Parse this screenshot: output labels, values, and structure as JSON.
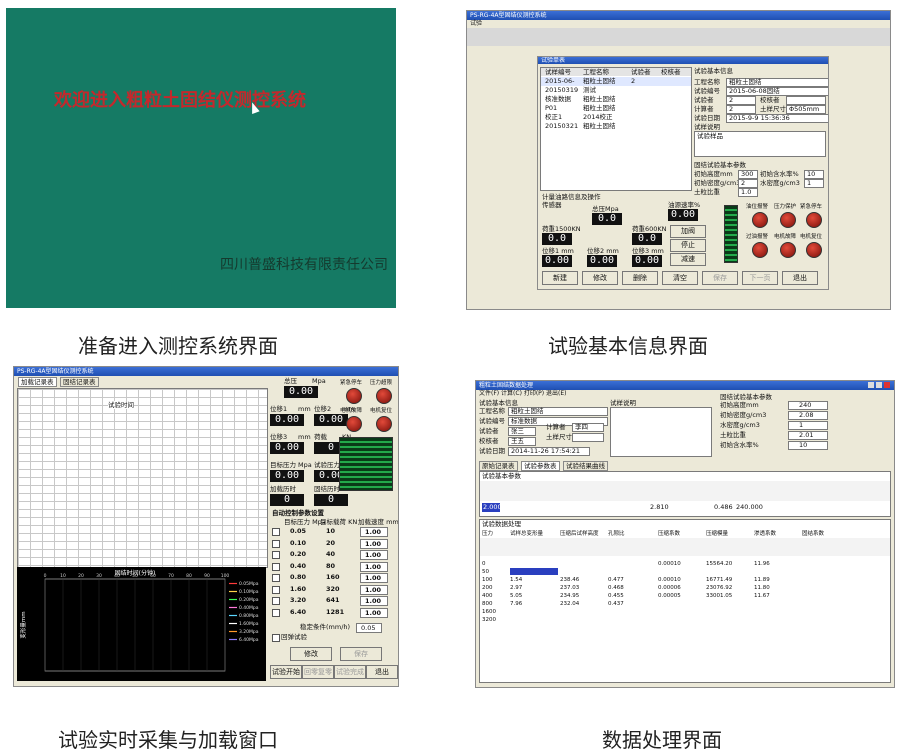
{
  "panel1": {
    "welcome": "欢迎进入粗粒土固结仪测控系统",
    "company": "四川普盛科技有限责任公司",
    "caption": "准备进入测控系统界面"
  },
  "panel2": {
    "caption": "试验基本信息界面",
    "window_title": "PS-RG-4A型固结仪测控系统",
    "menu": "试验",
    "group_list": "试验单表",
    "list_headers": [
      "试样编号",
      "工程名称",
      "试验者",
      "校核者"
    ],
    "list_rows": [
      [
        "2015-06-",
        "粗粒土固结",
        "2",
        ""
      ],
      [
        "20150319",
        "测试",
        "",
        ""
      ],
      [
        "核准数据",
        "粗粒土固结",
        "",
        ""
      ],
      [
        "P01",
        "粗粒土固结",
        "",
        ""
      ],
      [
        "校正1",
        "2014校正",
        "",
        ""
      ],
      [
        "20150321",
        "粗粒土固结",
        "",
        ""
      ]
    ],
    "basic_title": "试验基本信息",
    "fields": [
      {
        "label": "工程名称",
        "value": "粗粒土固结"
      },
      {
        "label": "试验编号",
        "value": "2015-06-08固结"
      },
      {
        "label": "试验者",
        "value": "2"
      },
      {
        "label": "计算者",
        "value": "2"
      },
      {
        "label": "试验日期",
        "value": "2015-9-9 15:36:36"
      }
    ],
    "checker_label": "校核者",
    "size_label": "土样尺寸",
    "size_value": "Φ505mm",
    "desc_label": "试样说明",
    "desc_value": "试验样品",
    "param_title": "固结试验基本参数",
    "params": [
      {
        "label": "初始高度mm",
        "value": "300"
      },
      {
        "label": "初始含水率%",
        "value": "10"
      },
      {
        "label": "初始密度g/cm3",
        "value": "2"
      },
      {
        "label": "水密度g/cm3",
        "value": "1"
      },
      {
        "label": "土粒比重",
        "value": "1.0"
      }
    ],
    "meter_title": "计量油路信息及操作",
    "sensor": "传感器",
    "total_label": "总压Mpa",
    "total_value": "0.0",
    "load1_label": "荷重1500KN",
    "load2_label": "荷重600KN",
    "load_value": "0.0",
    "disp_labels": [
      "位移1 mm",
      "位移2 mm",
      "位移3 mm"
    ],
    "disp_value": "0.00",
    "oil_label": "油源速率%",
    "oil_value": "0.00",
    "op_buttons": [
      "加阀",
      "停止",
      "减速"
    ],
    "status_labels": [
      "油位报警",
      "压力保护",
      "紧急停车",
      "过油报警",
      "电机故障",
      "电机复位"
    ],
    "buttons": [
      "新建",
      "修改",
      "删除",
      "清空",
      "保存",
      "下一页",
      "退出"
    ]
  },
  "panel3": {
    "caption": "试验实时采集与加载窗口",
    "window_title": "PS-RG-4A型固结仪测控系统",
    "tabs": [
      "加载记录表",
      "固结记录表"
    ],
    "table_title": "试验时间",
    "readouts": [
      {
        "label": "总压",
        "unit": "Mpa",
        "value": "0.00"
      },
      {
        "label": "位移1",
        "unit": "mm",
        "value": "0.00"
      },
      {
        "label": "位移2",
        "unit": "mm",
        "value": "0.00"
      },
      {
        "label": "位移3",
        "unit": "mm",
        "value": "0.00"
      },
      {
        "label": "荷载",
        "unit": "KN",
        "value": "0"
      },
      {
        "label": "目标压力",
        "unit": "Mpa",
        "value": "0.00"
      },
      {
        "label": "试验压力",
        "unit": "Mpa",
        "value": "0.00"
      },
      {
        "label": "加载历时",
        "unit": "",
        "value": "0"
      },
      {
        "label": "固结历时",
        "unit": "",
        "value": "0"
      }
    ],
    "alarm_labels": [
      "紧急停车",
      "压力超限",
      "电机故障",
      "电机复位"
    ],
    "control_title": "自动控制参数设置",
    "control_headers": [
      "目标压力 Mpa",
      "目标载荷 KN",
      "加载速度 mm/min"
    ],
    "control_rows": [
      [
        "0.05",
        "10",
        "1.00"
      ],
      [
        "0.10",
        "20",
        "1.00"
      ],
      [
        "0.20",
        "40",
        "1.00"
      ],
      [
        "0.40",
        "80",
        "1.00"
      ],
      [
        "0.80",
        "160",
        "1.00"
      ],
      [
        "1.60",
        "320",
        "1.00"
      ],
      [
        "3.20",
        "641",
        "1.00"
      ],
      [
        "6.40",
        "1281",
        "1.00"
      ]
    ],
    "stable_label": "稳定条件(mm/h)",
    "stable_value": "0.05",
    "loop_label": "回弹试验",
    "buttons": [
      "修改",
      "保存",
      "试验开始",
      "回零复零",
      "试验完成",
      "退出"
    ],
    "chart_title": "固结时间(分钟)",
    "ylabel": "变形量mm",
    "x_ticks": [
      "0",
      "10",
      "20",
      "30",
      "40",
      "50",
      "60",
      "70",
      "80",
      "90",
      "100"
    ],
    "legend": [
      "0.05Mpa",
      "0.10Mpa",
      "0.20Mpa",
      "0.40Mpa",
      "0.80Mpa",
      "1.60Mpa",
      "3.20Mpa",
      "6.40Mpa"
    ],
    "legend_colors": [
      "#ff3b3b",
      "#ffd24a",
      "#3bff5a",
      "#ff7ad9",
      "#5ad6ff",
      "#ffffff",
      "#ff9a2a",
      "#8c7cff"
    ]
  },
  "panel4": {
    "caption": "数据处理界面",
    "window_title": "粗粒土固结数据处理",
    "menu": "文件(F)  计算(C)  打印(P)  退出(E)",
    "basic_title": "试验基本信息",
    "fields": [
      {
        "label": "工程名称",
        "value": "粗粒土固结"
      },
      {
        "label": "试验编号",
        "value": "标准数据"
      },
      {
        "label": "试验者",
        "value": "张三"
      },
      {
        "label": "校核者",
        "value": "王五"
      },
      {
        "label": "试验日期",
        "value": "2014-11-26 17:54:21"
      }
    ],
    "calc_label": "计算者",
    "calc_value": "李四",
    "size_label": "土样尺寸",
    "desc_label": "试样说明",
    "param_title": "固结试验基本参数",
    "params": [
      {
        "label": "初始高度mm",
        "value": "240"
      },
      {
        "label": "初始密度g/cm3",
        "value": "2.08"
      },
      {
        "label": "水密度g/cm3",
        "value": "1"
      },
      {
        "label": "土粒比重",
        "value": "2.01"
      },
      {
        "label": "初始含水率%",
        "value": "10"
      }
    ],
    "tabs": [
      "原始记录表",
      "试验参数表",
      "试验结果曲线"
    ],
    "result_title": "试验基本参数",
    "result_values": [
      "2.000",
      "2.810",
      "0.486",
      "240.000"
    ],
    "proc_title": "试验数据处理",
    "proc_headers": [
      "压力",
      "试样总变形量",
      "压缩后试样高度",
      "孔隙比",
      "压缩系数",
      "压缩模量",
      "渗透系数",
      "固结系数"
    ],
    "proc_rows": [
      [
        "0",
        "",
        "",
        "",
        "0.00010",
        "15564.20",
        "11.96",
        ""
      ],
      [
        "50",
        "",
        "",
        "",
        "",
        "",
        "",
        ""
      ],
      [
        "100",
        "1.54",
        "238.46",
        "0.477",
        "0.00010",
        "16771.49",
        "11.89",
        ""
      ],
      [
        "200",
        "2.97",
        "237.03",
        "0.468",
        "0.00006",
        "23076.92",
        "11.80",
        ""
      ],
      [
        "400",
        "5.05",
        "234.95",
        "0.455",
        "0.00005",
        "33001.05",
        "11.67",
        ""
      ],
      [
        "800",
        "7.96",
        "232.04",
        "0.437",
        "",
        "",
        "",
        ""
      ],
      [
        "1600",
        "",
        "",
        "",
        "",
        "",
        "",
        ""
      ],
      [
        "3200",
        "",
        "",
        "",
        "",
        "",
        "",
        ""
      ]
    ]
  }
}
